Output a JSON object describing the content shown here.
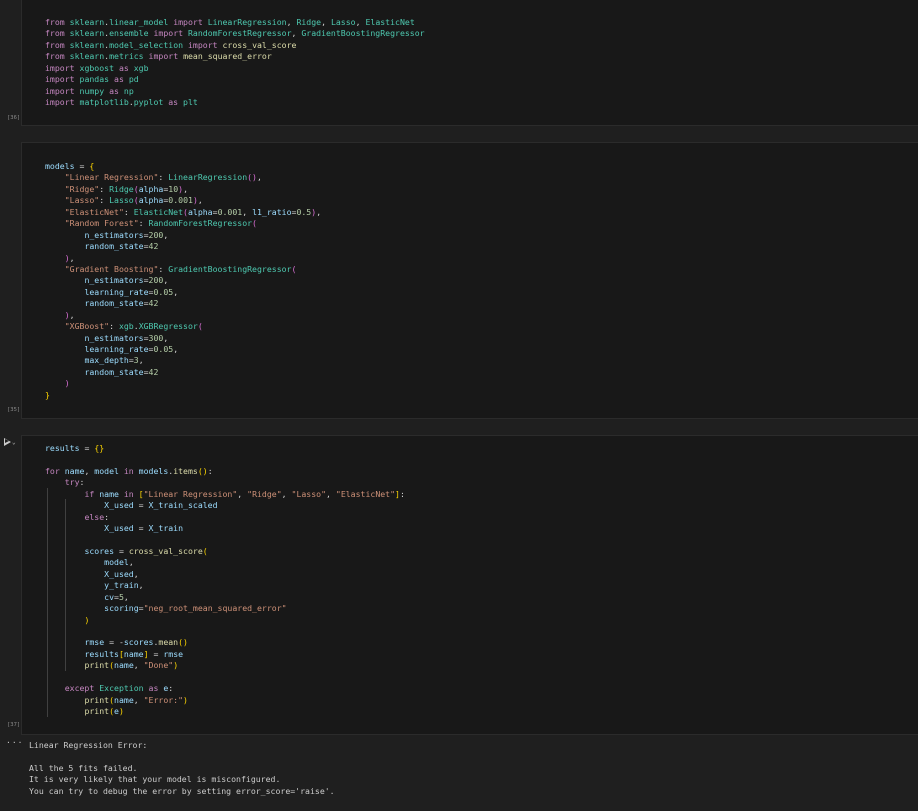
{
  "cells": [
    {
      "exec_count": "[36]",
      "lines": [
        [
          [
            "kw",
            "from "
          ],
          [
            "cls",
            "sklearn"
          ],
          [
            "op",
            "."
          ],
          [
            "cls",
            "linear_model"
          ],
          [
            "kw",
            " import "
          ],
          [
            "cls",
            "LinearRegression"
          ],
          [
            "op",
            ", "
          ],
          [
            "cls",
            "Ridge"
          ],
          [
            "op",
            ", "
          ],
          [
            "cls",
            "Lasso"
          ],
          [
            "op",
            ", "
          ],
          [
            "cls",
            "ElasticNet"
          ]
        ],
        [
          [
            "kw",
            "from "
          ],
          [
            "cls",
            "sklearn"
          ],
          [
            "op",
            "."
          ],
          [
            "cls",
            "ensemble"
          ],
          [
            "kw",
            " import "
          ],
          [
            "cls",
            "RandomForestRegressor"
          ],
          [
            "op",
            ", "
          ],
          [
            "cls",
            "GradientBoostingRegressor"
          ]
        ],
        [
          [
            "kw",
            "from "
          ],
          [
            "cls",
            "sklearn"
          ],
          [
            "op",
            "."
          ],
          [
            "cls",
            "model_selection"
          ],
          [
            "kw",
            " import "
          ],
          [
            "fn",
            "cross_val_score"
          ]
        ],
        [
          [
            "kw",
            "from "
          ],
          [
            "cls",
            "sklearn"
          ],
          [
            "op",
            "."
          ],
          [
            "cls",
            "metrics"
          ],
          [
            "kw",
            " import "
          ],
          [
            "fn",
            "mean_squared_error"
          ]
        ],
        [
          [
            "kw",
            "import "
          ],
          [
            "cls",
            "xgboost"
          ],
          [
            "kw",
            " as "
          ],
          [
            "cls",
            "xgb"
          ]
        ],
        [
          [
            "kw",
            "import "
          ],
          [
            "cls",
            "pandas"
          ],
          [
            "kw",
            " as "
          ],
          [
            "cls",
            "pd"
          ]
        ],
        [
          [
            "kw",
            "import "
          ],
          [
            "cls",
            "numpy"
          ],
          [
            "kw",
            " as "
          ],
          [
            "cls",
            "np"
          ]
        ],
        [
          [
            "kw",
            "import "
          ],
          [
            "cls",
            "matplotlib"
          ],
          [
            "op",
            "."
          ],
          [
            "cls",
            "pyplot"
          ],
          [
            "kw",
            " as "
          ],
          [
            "cls",
            "plt"
          ]
        ]
      ]
    },
    {
      "exec_count": "[35]",
      "lines": [
        [
          [
            "var",
            "models"
          ],
          [
            "op",
            " = "
          ],
          [
            "br1",
            "{"
          ]
        ],
        [
          [
            "op",
            "    "
          ],
          [
            "str",
            "\"Linear Regression\""
          ],
          [
            "op",
            ": "
          ],
          [
            "cls",
            "LinearRegression"
          ],
          [
            "br2",
            "()"
          ],
          [
            "op",
            ","
          ]
        ],
        [
          [
            "op",
            "    "
          ],
          [
            "str",
            "\"Ridge\""
          ],
          [
            "op",
            ": "
          ],
          [
            "cls",
            "Ridge"
          ],
          [
            "br2",
            "("
          ],
          [
            "var",
            "alpha"
          ],
          [
            "op",
            "="
          ],
          [
            "num",
            "10"
          ],
          [
            "br2",
            ")"
          ],
          [
            "op",
            ","
          ]
        ],
        [
          [
            "op",
            "    "
          ],
          [
            "str",
            "\"Lasso\""
          ],
          [
            "op",
            ": "
          ],
          [
            "cls",
            "Lasso"
          ],
          [
            "br2",
            "("
          ],
          [
            "var",
            "alpha"
          ],
          [
            "op",
            "="
          ],
          [
            "num",
            "0.001"
          ],
          [
            "br2",
            ")"
          ],
          [
            "op",
            ","
          ]
        ],
        [
          [
            "op",
            "    "
          ],
          [
            "str",
            "\"ElasticNet\""
          ],
          [
            "op",
            ": "
          ],
          [
            "cls",
            "ElasticNet"
          ],
          [
            "br2",
            "("
          ],
          [
            "var",
            "alpha"
          ],
          [
            "op",
            "="
          ],
          [
            "num",
            "0.001"
          ],
          [
            "op",
            ", "
          ],
          [
            "var",
            "l1_ratio"
          ],
          [
            "op",
            "="
          ],
          [
            "num",
            "0.5"
          ],
          [
            "br2",
            ")"
          ],
          [
            "op",
            ","
          ]
        ],
        [
          [
            "op",
            "    "
          ],
          [
            "str",
            "\"Random Forest\""
          ],
          [
            "op",
            ": "
          ],
          [
            "cls",
            "RandomForestRegressor"
          ],
          [
            "br2",
            "("
          ]
        ],
        [
          [
            "op",
            "        "
          ],
          [
            "var",
            "n_estimators"
          ],
          [
            "op",
            "="
          ],
          [
            "num",
            "200"
          ],
          [
            "op",
            ","
          ]
        ],
        [
          [
            "op",
            "        "
          ],
          [
            "var",
            "random_state"
          ],
          [
            "op",
            "="
          ],
          [
            "num",
            "42"
          ]
        ],
        [
          [
            "op",
            "    "
          ],
          [
            "br2",
            ")"
          ],
          [
            "op",
            ","
          ]
        ],
        [
          [
            "op",
            "    "
          ],
          [
            "str",
            "\"Gradient Boosting\""
          ],
          [
            "op",
            ": "
          ],
          [
            "cls",
            "GradientBoostingRegressor"
          ],
          [
            "br2",
            "("
          ]
        ],
        [
          [
            "op",
            "        "
          ],
          [
            "var",
            "n_estimators"
          ],
          [
            "op",
            "="
          ],
          [
            "num",
            "200"
          ],
          [
            "op",
            ","
          ]
        ],
        [
          [
            "op",
            "        "
          ],
          [
            "var",
            "learning_rate"
          ],
          [
            "op",
            "="
          ],
          [
            "num",
            "0.05"
          ],
          [
            "op",
            ","
          ]
        ],
        [
          [
            "op",
            "        "
          ],
          [
            "var",
            "random_state"
          ],
          [
            "op",
            "="
          ],
          [
            "num",
            "42"
          ]
        ],
        [
          [
            "op",
            "    "
          ],
          [
            "br2",
            ")"
          ],
          [
            "op",
            ","
          ]
        ],
        [
          [
            "op",
            "    "
          ],
          [
            "str",
            "\"XGBoost\""
          ],
          [
            "op",
            ": "
          ],
          [
            "cls",
            "xgb"
          ],
          [
            "op",
            "."
          ],
          [
            "cls",
            "XGBRegressor"
          ],
          [
            "br2",
            "("
          ]
        ],
        [
          [
            "op",
            "        "
          ],
          [
            "var",
            "n_estimators"
          ],
          [
            "op",
            "="
          ],
          [
            "num",
            "300"
          ],
          [
            "op",
            ","
          ]
        ],
        [
          [
            "op",
            "        "
          ],
          [
            "var",
            "learning_rate"
          ],
          [
            "op",
            "="
          ],
          [
            "num",
            "0.05"
          ],
          [
            "op",
            ","
          ]
        ],
        [
          [
            "op",
            "        "
          ],
          [
            "var",
            "max_depth"
          ],
          [
            "op",
            "="
          ],
          [
            "num",
            "3"
          ],
          [
            "op",
            ","
          ]
        ],
        [
          [
            "op",
            "        "
          ],
          [
            "var",
            "random_state"
          ],
          [
            "op",
            "="
          ],
          [
            "num",
            "42"
          ]
        ],
        [
          [
            "op",
            "    "
          ],
          [
            "br2",
            ")"
          ]
        ],
        [
          [
            "br1",
            "}"
          ]
        ]
      ]
    },
    {
      "exec_count": "[37]",
      "lines": [
        [
          [
            "var",
            "results"
          ],
          [
            "op",
            " = "
          ],
          [
            "br1",
            "{}"
          ]
        ],
        [
          [
            "op",
            ""
          ]
        ],
        [
          [
            "kw",
            "for "
          ],
          [
            "var",
            "name"
          ],
          [
            "op",
            ", "
          ],
          [
            "var",
            "model"
          ],
          [
            "kw",
            " in "
          ],
          [
            "var",
            "models"
          ],
          [
            "op",
            "."
          ],
          [
            "fn",
            "items"
          ],
          [
            "br1",
            "()"
          ],
          [
            "op",
            ":"
          ]
        ],
        [
          [
            "op",
            "    "
          ],
          [
            "kw",
            "try"
          ],
          [
            "op",
            ":"
          ]
        ],
        [
          [
            "op",
            "        "
          ],
          [
            "kw",
            "if "
          ],
          [
            "var",
            "name"
          ],
          [
            "kw",
            " in "
          ],
          [
            "br1",
            "["
          ],
          [
            "str",
            "\"Linear Regression\""
          ],
          [
            "op",
            ", "
          ],
          [
            "str",
            "\"Ridge\""
          ],
          [
            "op",
            ", "
          ],
          [
            "str",
            "\"Lasso\""
          ],
          [
            "op",
            ", "
          ],
          [
            "str",
            "\"ElasticNet\""
          ],
          [
            "br1",
            "]"
          ],
          [
            "op",
            ":"
          ]
        ],
        [
          [
            "op",
            "            "
          ],
          [
            "var",
            "X_used"
          ],
          [
            "op",
            " = "
          ],
          [
            "var",
            "X_train_scaled"
          ]
        ],
        [
          [
            "op",
            "        "
          ],
          [
            "kw",
            "else"
          ],
          [
            "op",
            ":"
          ]
        ],
        [
          [
            "op",
            "            "
          ],
          [
            "var",
            "X_used"
          ],
          [
            "op",
            " = "
          ],
          [
            "var",
            "X_train"
          ]
        ],
        [
          [
            "op",
            ""
          ]
        ],
        [
          [
            "op",
            "        "
          ],
          [
            "var",
            "scores"
          ],
          [
            "op",
            " = "
          ],
          [
            "fn",
            "cross_val_score"
          ],
          [
            "br1",
            "("
          ]
        ],
        [
          [
            "op",
            "            "
          ],
          [
            "var",
            "model"
          ],
          [
            "op",
            ","
          ]
        ],
        [
          [
            "op",
            "            "
          ],
          [
            "var",
            "X_used"
          ],
          [
            "op",
            ","
          ]
        ],
        [
          [
            "op",
            "            "
          ],
          [
            "var",
            "y_train"
          ],
          [
            "op",
            ","
          ]
        ],
        [
          [
            "op",
            "            "
          ],
          [
            "var",
            "cv"
          ],
          [
            "op",
            "="
          ],
          [
            "num",
            "5"
          ],
          [
            "op",
            ","
          ]
        ],
        [
          [
            "op",
            "            "
          ],
          [
            "var",
            "scoring"
          ],
          [
            "op",
            "="
          ],
          [
            "str",
            "\"neg_root_mean_squared_error\""
          ]
        ],
        [
          [
            "op",
            "        "
          ],
          [
            "br1",
            ")"
          ]
        ],
        [
          [
            "op",
            ""
          ]
        ],
        [
          [
            "op",
            "        "
          ],
          [
            "var",
            "rmse"
          ],
          [
            "op",
            " = -"
          ],
          [
            "var",
            "scores"
          ],
          [
            "op",
            "."
          ],
          [
            "fn",
            "mean"
          ],
          [
            "br1",
            "()"
          ]
        ],
        [
          [
            "op",
            "        "
          ],
          [
            "var",
            "results"
          ],
          [
            "br1",
            "["
          ],
          [
            "var",
            "name"
          ],
          [
            "br1",
            "]"
          ],
          [
            "op",
            " = "
          ],
          [
            "var",
            "rmse"
          ]
        ],
        [
          [
            "op",
            "        "
          ],
          [
            "fn",
            "print"
          ],
          [
            "br1",
            "("
          ],
          [
            "var",
            "name"
          ],
          [
            "op",
            ", "
          ],
          [
            "str",
            "\"Done\""
          ],
          [
            "br1",
            ")"
          ]
        ],
        [
          [
            "op",
            ""
          ]
        ],
        [
          [
            "op",
            "    "
          ],
          [
            "kw",
            "except "
          ],
          [
            "cls",
            "Exception"
          ],
          [
            "kw",
            " as "
          ],
          [
            "var",
            "e"
          ],
          [
            "op",
            ":"
          ]
        ],
        [
          [
            "op",
            "        "
          ],
          [
            "fn",
            "print"
          ],
          [
            "br1",
            "("
          ],
          [
            "var",
            "name"
          ],
          [
            "op",
            ", "
          ],
          [
            "str",
            "\"Error:\""
          ],
          [
            "br1",
            ")"
          ]
        ],
        [
          [
            "op",
            "        "
          ],
          [
            "fn",
            "print"
          ],
          [
            "br1",
            "("
          ],
          [
            "var",
            "e"
          ],
          [
            "br1",
            ")"
          ]
        ]
      ]
    }
  ],
  "output": {
    "menu_label": "···",
    "lines": [
      "Linear Regression Error:",
      "",
      "All the 5 fits failed.",
      "It is very likely that your model is misconfigured.",
      "You can try to debug the error by setting error_score='raise'."
    ]
  },
  "icons": {
    "run": "play-icon",
    "chevron": "chevron-down-icon"
  }
}
